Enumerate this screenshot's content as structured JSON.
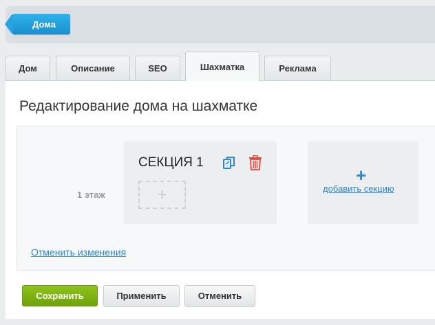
{
  "header": {
    "back_label": "Дома"
  },
  "tabs": [
    {
      "label": "Дом"
    },
    {
      "label": "Описание"
    },
    {
      "label": "SEO"
    },
    {
      "label": "Шахматка",
      "active": true
    },
    {
      "label": "Реклама"
    }
  ],
  "panel": {
    "title": "Редактирование дома на шахматке",
    "floor_label": "1 этаж",
    "section": {
      "title": "СЕКЦИЯ 1",
      "add_floor_symbol": "+"
    },
    "add_section": {
      "symbol": "+",
      "label": "добавить секцию"
    },
    "cancel_changes_label": "Отменить изменения"
  },
  "actions": {
    "save_label": "Сохранить",
    "apply_label": "Применить",
    "cancel_label": "Отменить"
  },
  "colors": {
    "accent_blue": "#2d86d2",
    "save_green": "#7ab315",
    "delete_red": "#e0453b"
  },
  "icons": {
    "copy": "copy-icon",
    "delete": "trash-icon"
  }
}
